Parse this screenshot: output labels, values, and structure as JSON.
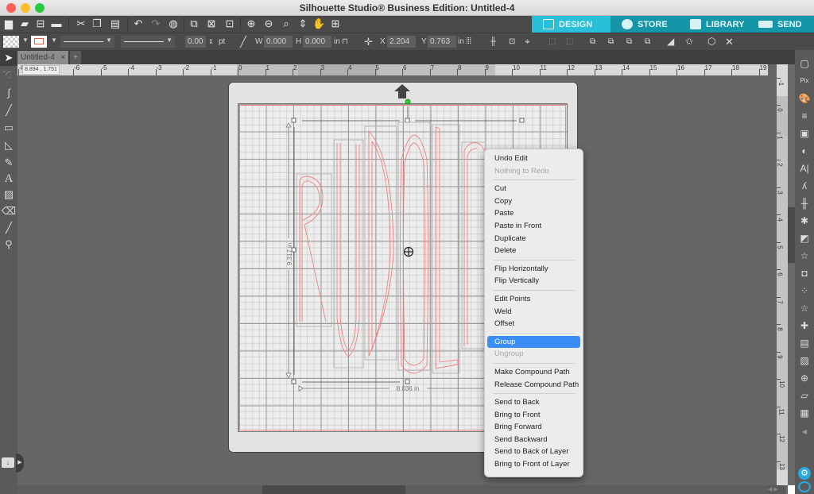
{
  "window": {
    "title": "Silhouette Studio® Business Edition: Untitled-4"
  },
  "nav_tabs": [
    {
      "label": "DESIGN",
      "icon": "grid-icon",
      "active": true
    },
    {
      "label": "STORE",
      "icon": "store-s-icon",
      "active": false
    },
    {
      "label": "LIBRARY",
      "icon": "library-download-icon",
      "active": false
    },
    {
      "label": "SEND",
      "icon": "cutter-send-icon",
      "active": false
    }
  ],
  "toolbar1": {
    "icons": [
      "new-file-icon",
      "open-folder-icon",
      "save-icon",
      "print-icon",
      "cut-icon",
      "copy-icon",
      "paste-icon",
      "undo-icon",
      "redo-icon",
      "refresh-globe-icon",
      "select-all-icon",
      "deselect-icon",
      "select-by-color-icon",
      "zoom-in-icon",
      "zoom-out-icon",
      "zoom-selection-icon",
      "fit-to-page-icon",
      "pan-hand-icon",
      "add-page-icon"
    ]
  },
  "toolbar2": {
    "line_width_value": "0.00",
    "line_width_unit": "pt",
    "w_label": "W",
    "w_value": "0.000",
    "h_label": "H",
    "h_value": "0.000",
    "size_unit": "in",
    "x_label": "X",
    "x_value": "2.204",
    "y_label": "Y",
    "y_value": "0.763",
    "pos_unit": "in"
  },
  "document_tab": {
    "label": "Untitled-4",
    "close": "×",
    "add": "+"
  },
  "cursor_coordinates": "8.894 , 1.751",
  "hruler_ticks": [
    "-8",
    "-6",
    "-5",
    "-4",
    "-3",
    "-2",
    "-1",
    "0",
    "1",
    "2",
    "3",
    "4",
    "5",
    "6",
    "7",
    "8",
    "9",
    "10",
    "11",
    "12",
    "13",
    "14",
    "15",
    "16",
    "17",
    "18",
    "19"
  ],
  "vruler_ticks": [
    "-1",
    "0",
    "1",
    "2",
    "3",
    "4",
    "5",
    "6",
    "7",
    "8",
    "9",
    "10",
    "11",
    "12",
    "13"
  ],
  "canvas": {
    "height_dimension": "9.317 in",
    "width_dimension": "8.036 in",
    "text_design": "RUDOLPH"
  },
  "context_menu": {
    "items": [
      {
        "label": "Undo Edit",
        "enabled": true
      },
      {
        "label": "Nothing to Redo",
        "enabled": false
      },
      {
        "sep": true
      },
      {
        "label": "Cut",
        "enabled": true
      },
      {
        "label": "Copy",
        "enabled": true
      },
      {
        "label": "Paste",
        "enabled": true
      },
      {
        "label": "Paste in Front",
        "enabled": true
      },
      {
        "label": "Duplicate",
        "enabled": true
      },
      {
        "label": "Delete",
        "enabled": true
      },
      {
        "sep": true
      },
      {
        "label": "Flip Horizontally",
        "enabled": true
      },
      {
        "label": "Flip Vertically",
        "enabled": true
      },
      {
        "sep": true
      },
      {
        "label": "Edit Points",
        "enabled": true
      },
      {
        "label": "Weld",
        "enabled": true
      },
      {
        "label": "Offset",
        "enabled": true
      },
      {
        "sep": true
      },
      {
        "label": "Group",
        "enabled": true,
        "highlighted": true
      },
      {
        "label": "Ungroup",
        "enabled": false
      },
      {
        "sep": true
      },
      {
        "label": "Make Compound Path",
        "enabled": true
      },
      {
        "label": "Release Compound Path",
        "enabled": true
      },
      {
        "sep": true
      },
      {
        "label": "Send to Back",
        "enabled": true
      },
      {
        "label": "Bring to Front",
        "enabled": true
      },
      {
        "label": "Bring Forward",
        "enabled": true
      },
      {
        "label": "Send Backward",
        "enabled": true
      },
      {
        "label": "Send to Back of Layer",
        "enabled": true
      },
      {
        "label": "Bring to Front of Layer",
        "enabled": true
      }
    ]
  },
  "colors": {
    "nav_active": "#27c0d8",
    "nav_inactive": "#1596a8",
    "cut_line": "#f08080",
    "menu_highlight": "#3b8ef5"
  }
}
